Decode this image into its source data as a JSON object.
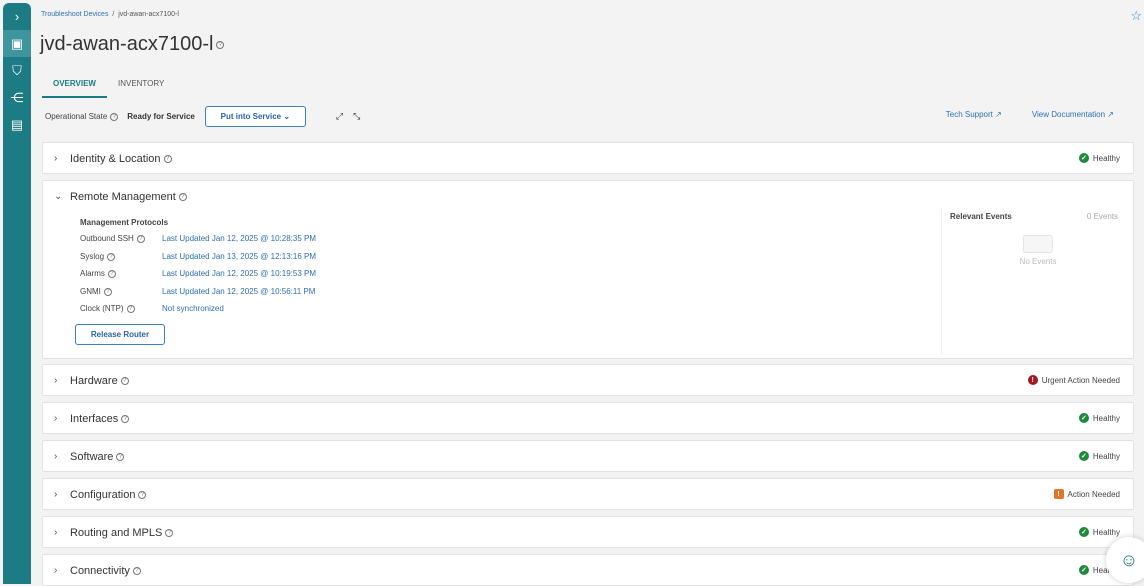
{
  "sidebar": {
    "items": [
      "expand",
      "monitor",
      "security",
      "topology",
      "reports"
    ]
  },
  "breadcrumb": {
    "parent": "Troubleshoot Devices",
    "current": "jvd-awan-acx7100-l"
  },
  "title": "jvd-awan-acx7100-l",
  "tabs": [
    "OVERVIEW",
    "INVENTORY"
  ],
  "operational": {
    "label": "Operational State",
    "value": "Ready for Service",
    "button": "Put into Service"
  },
  "links": {
    "tech_support": "Tech Support",
    "docs": "View Documentation"
  },
  "sections": [
    {
      "title": "Identity & Location",
      "status": "Healthy",
      "kind": "healthy"
    },
    {
      "title": "Remote Management",
      "status": "",
      "kind": "expanded"
    },
    {
      "title": "Hardware",
      "status": "Urgent Action Needed",
      "kind": "urgent"
    },
    {
      "title": "Interfaces",
      "status": "Healthy",
      "kind": "healthy"
    },
    {
      "title": "Software",
      "status": "Healthy",
      "kind": "healthy"
    },
    {
      "title": "Configuration",
      "status": "Action Needed",
      "kind": "action"
    },
    {
      "title": "Routing and MPLS",
      "status": "Healthy",
      "kind": "healthy"
    },
    {
      "title": "Connectivity",
      "status": "Healthy",
      "kind": "healthy"
    }
  ],
  "remote": {
    "heading": "Management Protocols",
    "rows": [
      {
        "k": "Outbound SSH",
        "v": "Last Updated Jan 12, 2025 @ 10:28:35 PM"
      },
      {
        "k": "Syslog",
        "v": "Last Updated Jan 13, 2025 @ 12:13:16 PM"
      },
      {
        "k": "Alarms",
        "v": "Last Updated Jan 12, 2025 @ 10:19:53 PM"
      },
      {
        "k": "GNMI",
        "v": "Last Updated Jan 12, 2025 @ 10:56:11 PM"
      },
      {
        "k": "Clock (NTP)",
        "v": "Not synchronized"
      }
    ],
    "button": "Release Router",
    "events_title": "Relevant Events",
    "events_count": "0 Events",
    "no_events": "No Events"
  }
}
